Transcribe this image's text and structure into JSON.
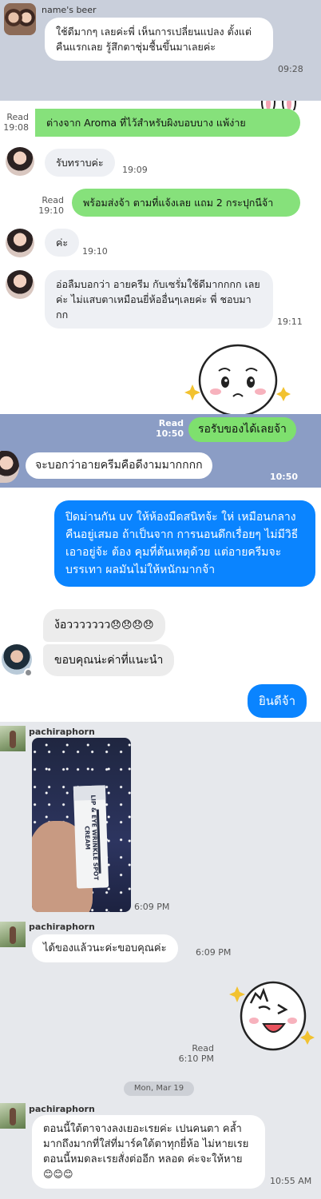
{
  "s1": {
    "sender": "name's beer",
    "message": "ใช้ดีมากๆ เลยค่ะพี่ เห็นการเปลี่ยนแปลง ตั้งแต่คืนแรกเลย รู้สึกตาชุ่มชื้นขึ้นมาเลยค่ะ",
    "time": "09:28"
  },
  "s2": {
    "msg1": {
      "read": "Read",
      "time": "19:08",
      "text": "ต่างจาก Aroma ที่ไว้สำหรับผิงบอบบาง แพ้ง่าย"
    },
    "msg2": {
      "text": "รับทราบค่ะ",
      "time": "19:09"
    },
    "msg3": {
      "read": "Read",
      "time": "19:10",
      "text": "พร้อมส่งจ้า ตามที่แจ้งเลย แถม 2 กระปุกนีจ้า"
    },
    "msg4": {
      "text": "ค่ะ",
      "time": "19:10"
    },
    "msg5": {
      "text": "อ่อลืมบอกว่า อายครีม กับเซรั่มใช้ดีมากกกก เลยค่ะ ไม่แสบตาเหมือนยี่ห้ออื่นๆเลยค่ะ พี่ ชอบมากก",
      "time": "19:11"
    }
  },
  "s3": {
    "read": "Read",
    "read_time": "10:50",
    "out_text": "รอรับของได้เลยจ้า",
    "in_text": "จะบอกว่าอายครีมคือดีงามมากกกก",
    "in_time": "10:50"
  },
  "s4": {
    "blue1": "ปิดม่านกัน uv ให้ห้องมืดสนิทจ้ะ ให่ เหมือนกลางคืนอยู่เสมอ  ถ้าเป็นจาก การนอนดึกเรื่อยๆ ไม่มีวิธีเอาอยู่จ้ะ ต้อง คุมที่ต้นเหตุด้วย แต่อายครีมจะบรรเทา ผลมันไม่ให้หนักมากจ้า",
    "gray1": "ง้อววววววว",
    "emoji1": "😞😞😞😞",
    "gray2": "ขอบคุณน่ะค่าที่แนะนำ",
    "blue2": "ยินดีจ้า"
  },
  "s5": {
    "sender1": "pachiraphorn",
    "product_label": "LIP & EYE WRINKLE SPOT CREAM",
    "photo_time": "6:09 PM",
    "sender2": "pachiraphorn",
    "msg2": "ได้ของแล้วนะค่ะขอบคุณค่ะ",
    "msg2_time": "6:09 PM",
    "read": "Read",
    "read_time": "6:10 PM",
    "date_chip": "Mon, Mar 19",
    "sender3": "pachiraphorn",
    "msg3": "ตอนนี้ใต้ตาจางลงเยอะเรยค่ะ เปนคนตา คล้ำมากถึงมากที่ใส่ที่มาร์คใต้ตาทุกยี่ห้อ ไม่หายเรย  ตอนนี้หมดละเรยสั่งต่ออีก หลอด ค่ะจะให้หาย",
    "msg3_emoji": "😊😊😊",
    "msg3_time": "10:55 AM"
  },
  "colors": {
    "line_bg": "#8b9dc5",
    "line_green": "#86e17b",
    "messenger_blue": "#0a84ff",
    "bubble_gray": "#ececec",
    "panel5_bg": "#e6e8ec"
  },
  "icons": [
    "sticker-bunny",
    "sticker-crying-face",
    "sticker-peace-face",
    "sparkle-icon",
    "messenger-badge-icon"
  ]
}
